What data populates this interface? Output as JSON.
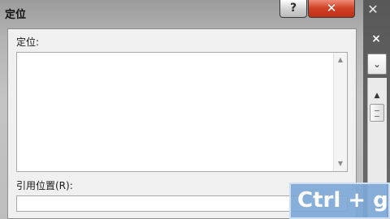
{
  "dialog": {
    "title": "定位",
    "help_glyph": "?",
    "close_glyph": "✕",
    "goto_label": "定位:",
    "list_items": [],
    "list_scroll_up_glyph": "▲",
    "list_scroll_down_glyph": "▼",
    "reference_label": "引用位置(R):",
    "reference_value": ""
  },
  "background_app": {
    "close_glyph": "✕",
    "small_close_glyph": "×",
    "dropdown_glyph": "⌄",
    "scroll_up_glyph": "▲"
  },
  "shortcut_overlay": {
    "text": "Ctrl + g"
  },
  "colors": {
    "close_button": "#d2452b",
    "shortcut_overlay": "#7ea8d6",
    "client_area": "#f0f0f0"
  },
  "icons": {
    "help": "question-mark-icon",
    "close": "close-icon",
    "scroll_up": "arrow-up-icon",
    "scroll_down": "arrow-down-icon",
    "dropdown": "chevron-down-icon"
  }
}
